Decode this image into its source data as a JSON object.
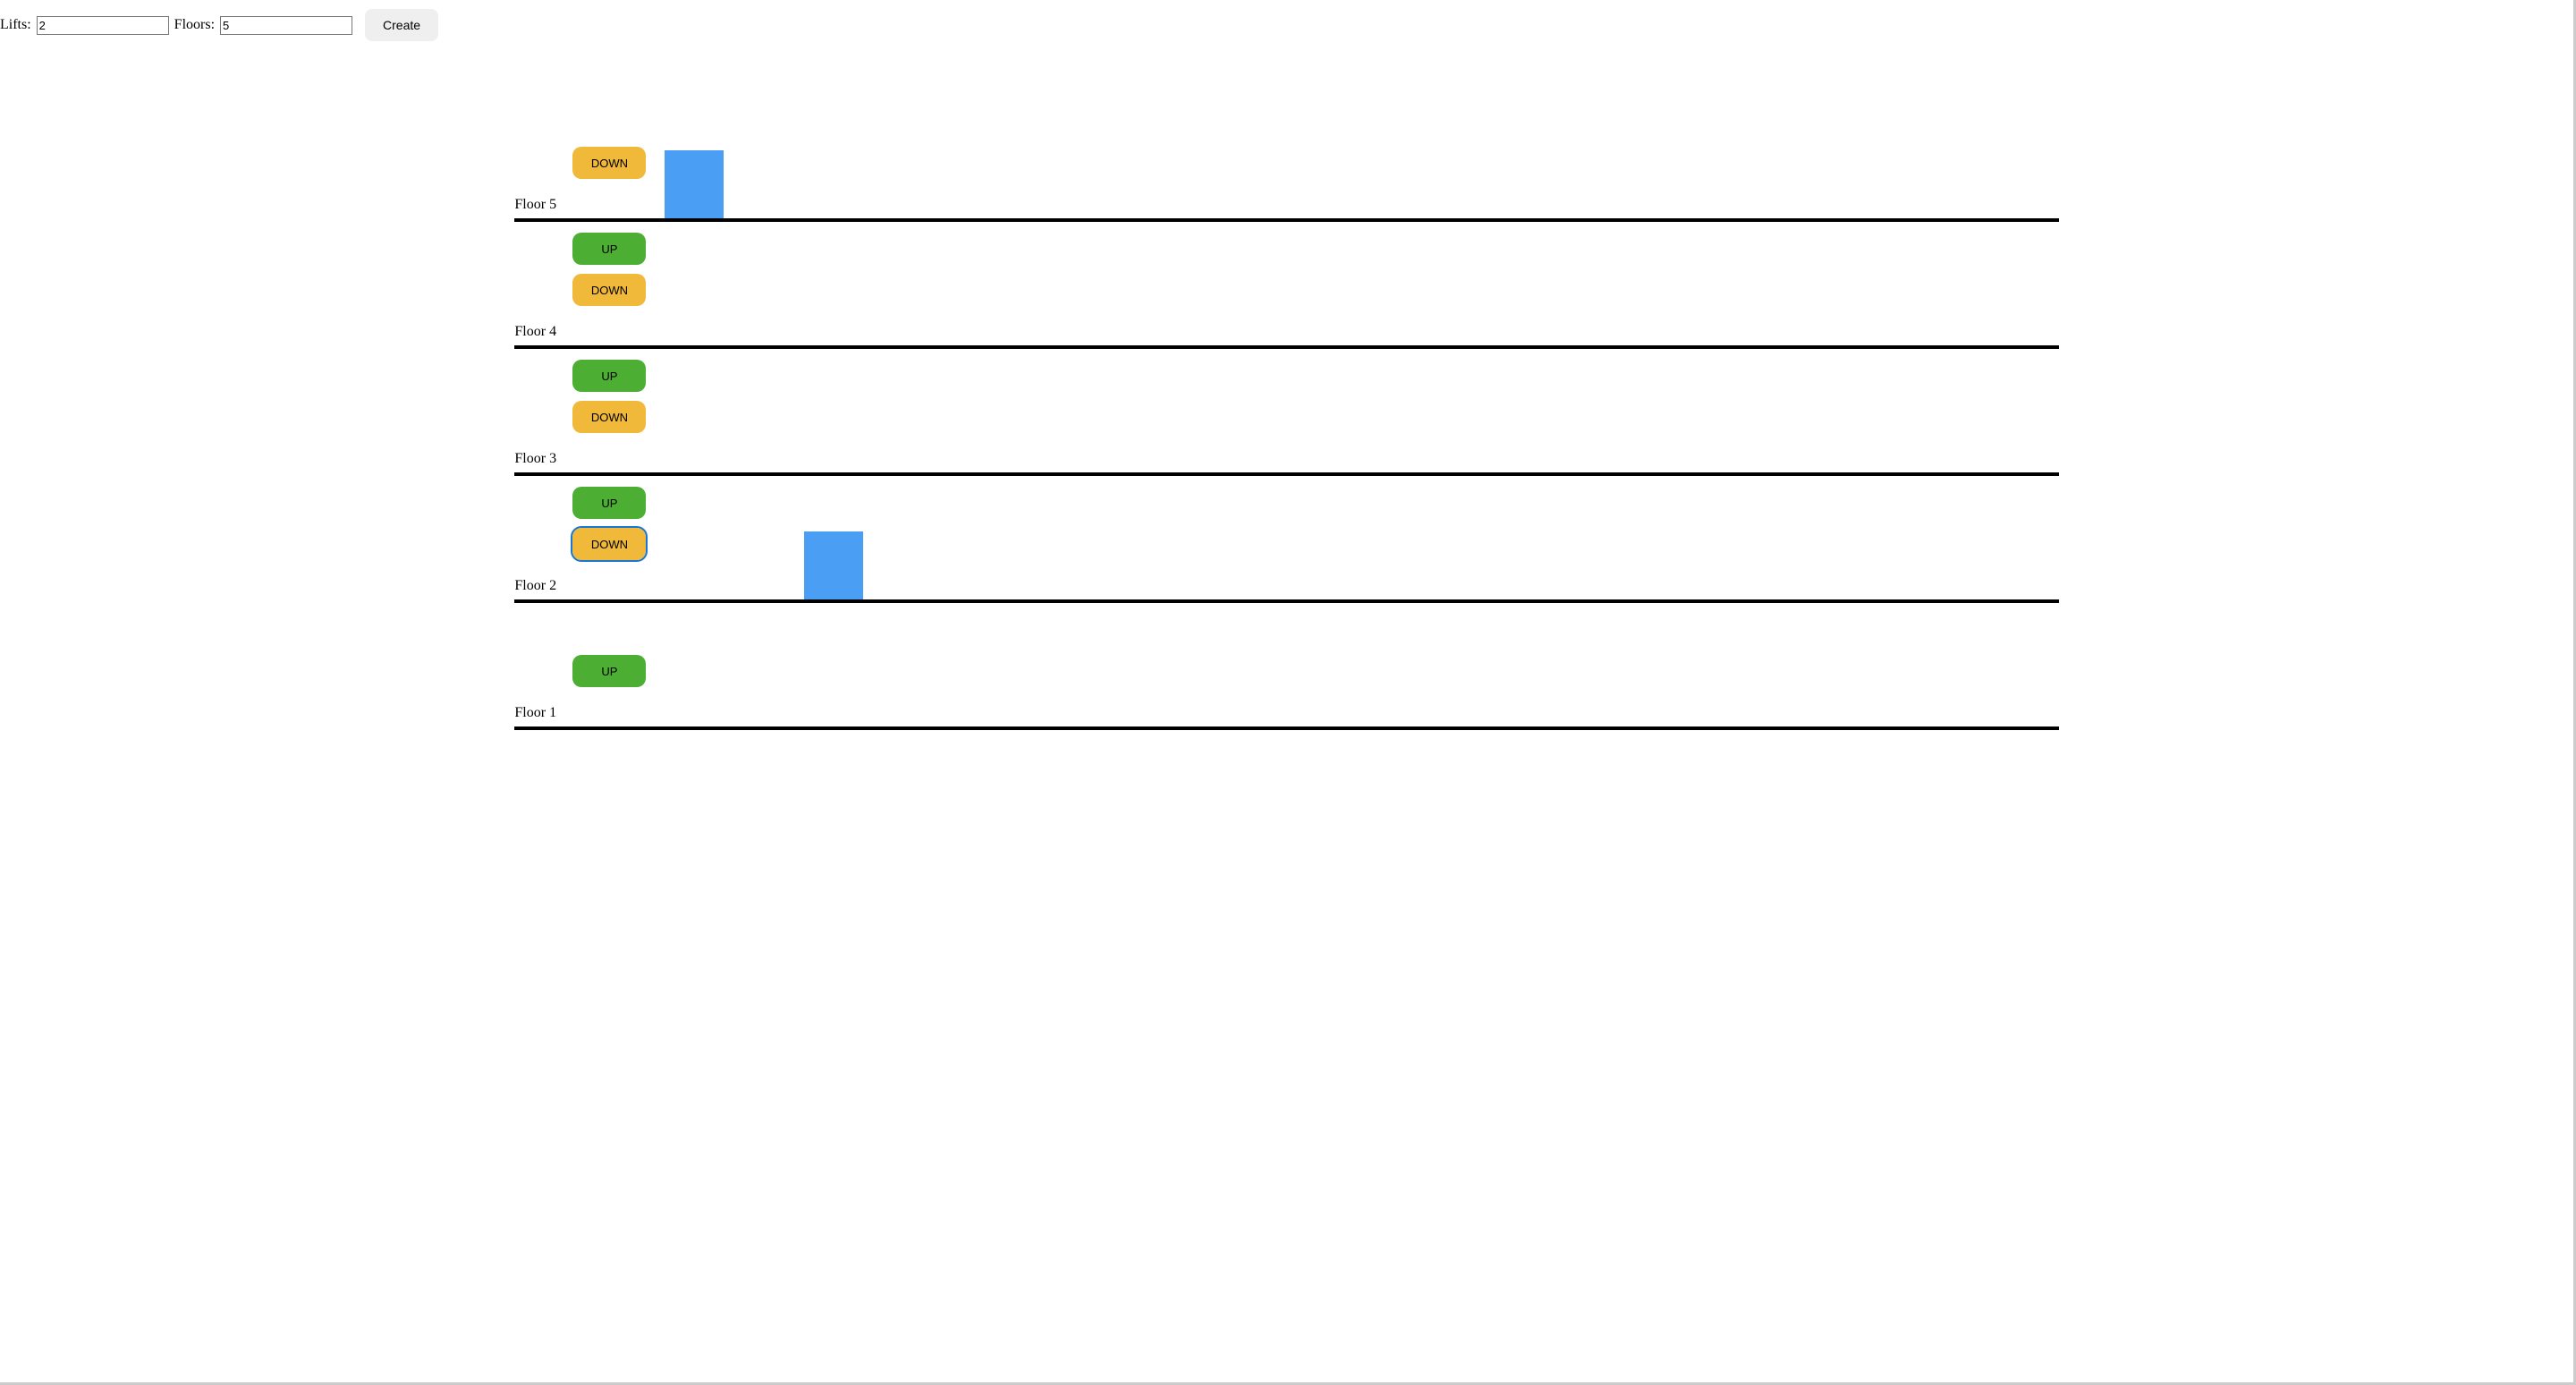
{
  "controls": {
    "lifts_label": "Lifts:",
    "lifts_value": "2",
    "floors_label": "Floors:",
    "floors_value": "5",
    "create_label": "Create"
  },
  "buttons": {
    "up_label": "UP",
    "down_label": "DOWN"
  },
  "floors": [
    {
      "id": 5,
      "label": "Floor 5",
      "has_up": false,
      "has_down": true,
      "down_focused": false
    },
    {
      "id": 4,
      "label": "Floor 4",
      "has_up": true,
      "has_down": true,
      "down_focused": false
    },
    {
      "id": 3,
      "label": "Floor 3",
      "has_up": true,
      "has_down": true,
      "down_focused": false
    },
    {
      "id": 2,
      "label": "Floor 2",
      "has_up": true,
      "has_down": true,
      "down_focused": true
    },
    {
      "id": 1,
      "label": "Floor 1",
      "has_up": true,
      "has_down": false,
      "down_focused": false
    }
  ],
  "lifts": [
    {
      "id": 1,
      "at_floor": 5,
      "slot": 1
    },
    {
      "id": 2,
      "at_floor": 2,
      "slot": 2
    }
  ]
}
